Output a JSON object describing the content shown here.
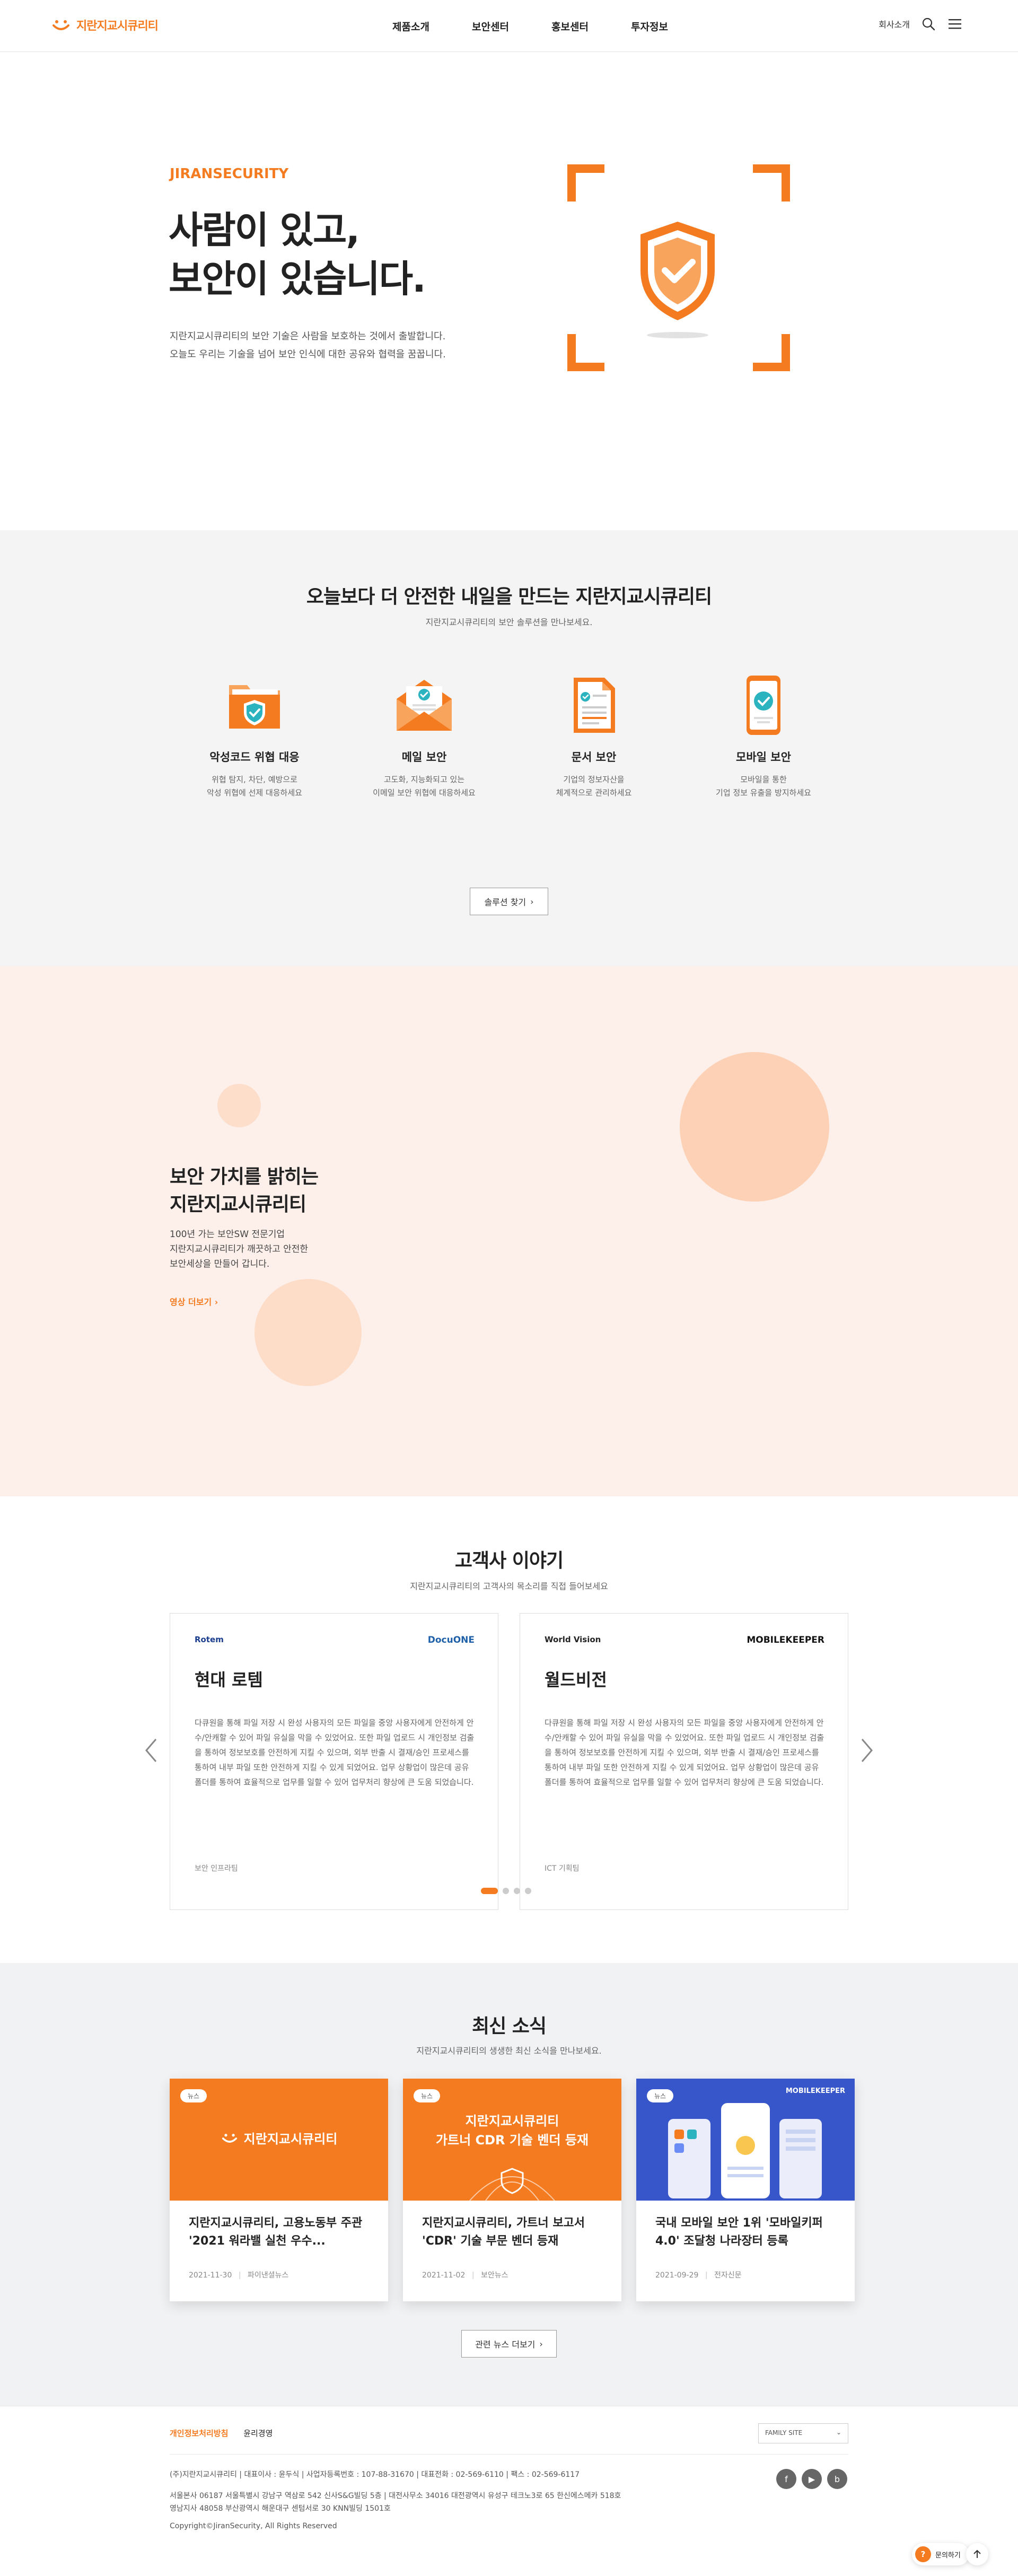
{
  "header": {
    "logo_text": "지란지교시큐리티",
    "nav": [
      "제품소개",
      "보안센터",
      "홍보센터",
      "투자정보"
    ],
    "about_label": "회사소개"
  },
  "hero": {
    "brand": "JIRANSECURITY",
    "title_line1": "사람이 있고,",
    "title_line2": "보안이 있습니다.",
    "desc_line1": "지란지교시큐리티의 보안 기술은 사람을 보호하는 것에서 출발합니다.",
    "desc_line2": "오늘도 우리는 기술을 넘어 보안 인식에 대한 공유와 협력을 꿈꿉니다."
  },
  "solutions": {
    "title": "오늘보다 더 안전한 내일을 만드는 지란지교시큐리티",
    "subtitle": "지란지교시큐리티의 보안 솔루션을 만나보세요.",
    "items": [
      {
        "name": "악성코드 위협 대응",
        "desc1": "위협 탐지, 차단, 예방으로",
        "desc2": "악성 위협에 선제 대응하세요",
        "icon": "folder-shield-icon"
      },
      {
        "name": "메일 보안",
        "desc1": "고도화, 지능화되고 있는",
        "desc2": "이메일 보안 위협에 대응하세요",
        "icon": "mail-check-icon"
      },
      {
        "name": "문서 보안",
        "desc1": "기업의 정보자산을",
        "desc2": "체계적으로 관리하세요",
        "icon": "document-check-icon"
      },
      {
        "name": "모바일 보안",
        "desc1": "모바일을 통한",
        "desc2": "기업 정보 유출을 방지하세요",
        "icon": "mobile-check-icon"
      }
    ],
    "button": "솔루션 찾기"
  },
  "value": {
    "title_line1": "보안 가치를 밝히는",
    "title_line2": "지란지교시큐리티",
    "desc_line1": "100년 가는 보안SW 전문기업",
    "desc_line2": "지란지교시큐리티가 깨끗하고 안전한",
    "desc_line3": "보안세상을 만들어 갑니다.",
    "link": "영상 더보기"
  },
  "stories": {
    "title": "고객사 이야기",
    "subtitle": "지란지교시큐리티의 고객사의 목소리를 직접 들어보세요",
    "cards": [
      {
        "logo_left": "Rotem",
        "logo_right": "DocuONE",
        "title": "현대 로템",
        "body": "다큐원을 통해 파일 저장 시 완성 사용자의 모든 파일을 중앙 사용자에게 안전하게 안수/안캐할 수 있어 파일 유실을 막을 수 있었어요. 또한 파일 업로드 시 개인정보 검출을 통하여 정보보호를 안전하게 지킬 수 있으며, 외부 반출 시 결재/승인 프로세스를 통하여 내부 파일 또한 안전하게 지킬 수 있게 되었어요. 업무 상황업이 많은데 공유폴더를 통하여 효율적으로 업무를 일할 수 있어 업무처리 향상에 큰 도움 되었습니다.",
        "tag": "보안 인프라팀"
      },
      {
        "logo_left": "World Vision",
        "logo_right": "MOBILEKEEPER",
        "title": "월드비전",
        "body": "다큐원을 통해 파일 저장 시 완성 사용자의 모든 파일을 중앙 사용자에게 안전하게 안수/안캐할 수 있어 파일 유실을 막을 수 있었어요. 또한 파일 업로드 시 개인정보 검출을 통하여 정보보호를 안전하게 지킬 수 있으며, 외부 반출 시 결재/승인 프로세스를 통하여 내부 파일 또한 안전하게 지킬 수 있게 되었어요. 업무 상황업이 많은데 공유폴더를 통하여 효율적으로 업무를 일할 수 있어 업무처리 향상에 큰 도움 되었습니다.",
        "tag": "ICT 기획팀"
      }
    ]
  },
  "news": {
    "title": "최신 소식",
    "subtitle": "지란지교시큐리티의 생생한 최신 소식을 만나보세요.",
    "cards": [
      {
        "badge": "뉴스",
        "thumb_text": "지란지교시큐리티",
        "title": "지란지교시큐리티, 고용노동부 주관 '2021 워라밸 실천 우수...",
        "date": "2021-11-30",
        "source": "파이낸셜뉴스"
      },
      {
        "badge": "뉴스",
        "thumb_line1": "지란지교시큐리티",
        "thumb_line2": "가트너 CDR 기술 벤더 등재",
        "title": "지란지교시큐리티, 가트너 보고서 'CDR' 기술 부문 벤더 등재",
        "date": "2021-11-02",
        "source": "보안뉴스"
      },
      {
        "badge": "뉴스",
        "thumb_brand": "MOBILEKEEPER",
        "title": "국내 모바일 보안 1위 '모바일키퍼 4.0' 조달청 나라장터 등록",
        "date": "2021-09-29",
        "source": "전자신문"
      }
    ],
    "button": "관련 뉴스 더보기"
  },
  "footer": {
    "link_privacy": "개인정보처리방침",
    "link_email": "윤리경영",
    "family_site": "FAMILY SITE",
    "company_line": "(주)지란지교시큐리티 | 대표이사 : 윤두식 | 사업자등록번호 : 107-88-31670 | 대표전화 : 02-569-6110 | 팩스 : 02-569-6117",
    "address_line1": "서울본사 06187 서울특별시 강남구 역삼로 542 신사S&G빌딩 5층 | 대전사무소 34016 대전광역시 유성구 테크노3로 65 한신에스메카 518호",
    "address_line2": "영남지사 48058 부산광역시 해운대구 센텀서로 30 KNN빌딩 1501호",
    "copyright": "Copyright©JiranSecurity, All Rights Reserved",
    "inquiry": "문의하기"
  }
}
